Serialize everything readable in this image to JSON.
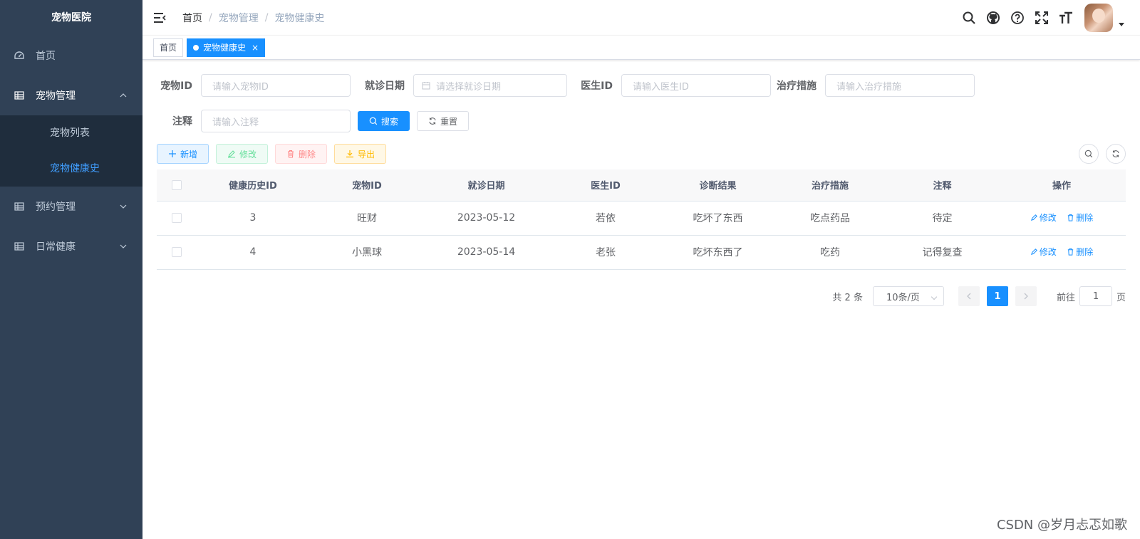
{
  "sidebar": {
    "logo": "宠物医院",
    "menu": [
      {
        "label": "首页",
        "icon": "dashboard-icon"
      },
      {
        "label": "宠物管理",
        "icon": "table-icon",
        "open": true,
        "children": [
          {
            "label": "宠物列表"
          },
          {
            "label": "宠物健康史",
            "active": true
          }
        ]
      },
      {
        "label": "预约管理",
        "icon": "table-icon"
      },
      {
        "label": "日常健康",
        "icon": "table-icon"
      }
    ]
  },
  "navbar": {
    "breadcrumb": [
      "首页",
      "宠物管理",
      "宠物健康史"
    ],
    "breadcrumb_sep": "/",
    "icons": [
      "search-icon",
      "github-icon",
      "help-icon",
      "fullscreen-icon",
      "font-size-icon"
    ]
  },
  "tags": [
    {
      "label": "首页"
    },
    {
      "label": "宠物健康史",
      "active": true,
      "close": "×"
    }
  ],
  "search_form": {
    "pet_id": {
      "label": "宠物ID",
      "placeholder": "请输入宠物ID"
    },
    "visit_date": {
      "label": "就诊日期",
      "placeholder": "请选择就诊日期"
    },
    "doctor_id": {
      "label": "医生ID",
      "placeholder": "请输入医生ID"
    },
    "treatment": {
      "label": "治疗措施",
      "placeholder": "请输入治疗措施"
    },
    "note": {
      "label": "注释",
      "placeholder": "请输入注释"
    },
    "search_label": "搜索",
    "reset_label": "重置"
  },
  "toolbar": {
    "add": "新增",
    "edit": "修改",
    "delete": "删除",
    "export": "导出"
  },
  "table": {
    "headers": [
      "健康历史ID",
      "宠物ID",
      "就诊日期",
      "医生ID",
      "诊断结果",
      "治疗措施",
      "注释",
      "操作"
    ],
    "rows": [
      {
        "id": "3",
        "pet": "旺财",
        "date": "2023-05-12",
        "doctor": "若依",
        "diagnosis": "吃坏了东西",
        "treatment": "吃点药品",
        "note": "待定"
      },
      {
        "id": "4",
        "pet": "小黑球",
        "date": "2023-05-14",
        "doctor": "老张",
        "diagnosis": "吃坏东西了",
        "treatment": "吃药",
        "note": "记得复查"
      }
    ],
    "op_edit": "修改",
    "op_delete": "删除"
  },
  "pagination": {
    "total": "共 2 条",
    "page_size": "10条/页",
    "current": "1",
    "goto_prefix": "前往",
    "goto_value": "1",
    "goto_suffix": "页"
  },
  "watermark": "CSDN @岁月忐忑如歌",
  "colors": {
    "sidebar": "#304156",
    "primary": "#1890ff",
    "active_menu": "#409eff"
  }
}
